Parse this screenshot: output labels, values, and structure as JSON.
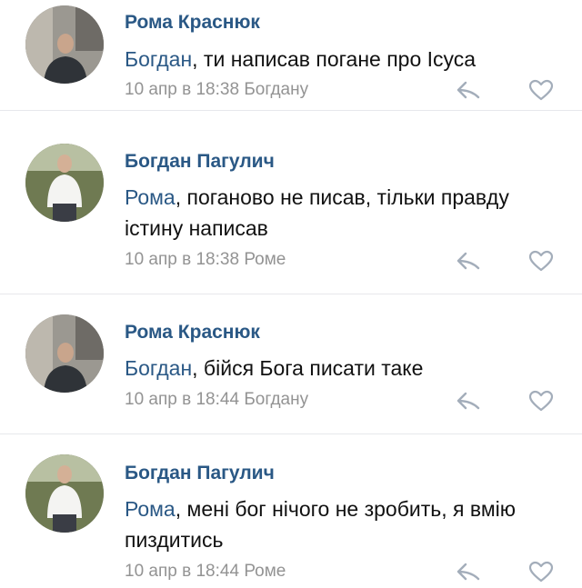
{
  "comments": [
    {
      "author": "Рома Краснюк",
      "reply_to": "Богдан",
      "text": ", ти написав погане про Ісуса",
      "date": "10 апр в 18:38",
      "reply_target": "Богдану",
      "avatar_icon": "person-photo"
    },
    {
      "author": "Богдан Пагулич",
      "reply_to": "Рома",
      "text": ", поганово не писав, тільки правду істину написав",
      "date": "10 апр в 18:38",
      "reply_target": "Роме",
      "avatar_icon": "person-photo"
    },
    {
      "author": "Рома Краснюк",
      "reply_to": "Богдан",
      "text": ", бійся Бога писати таке",
      "date": "10 апр в 18:44",
      "reply_target": "Богдану",
      "avatar_icon": "person-photo"
    },
    {
      "author": "Богдан Пагулич",
      "reply_to": "Рома",
      "text": ", мені бог нічого не зробить, я вмію пиздитись",
      "date": "10 апр в 18:44",
      "reply_target": "Роме",
      "avatar_icon": "person-photo"
    }
  ],
  "colors": {
    "link": "#2a5885",
    "meta": "#939393",
    "icon": "#a3adba"
  }
}
